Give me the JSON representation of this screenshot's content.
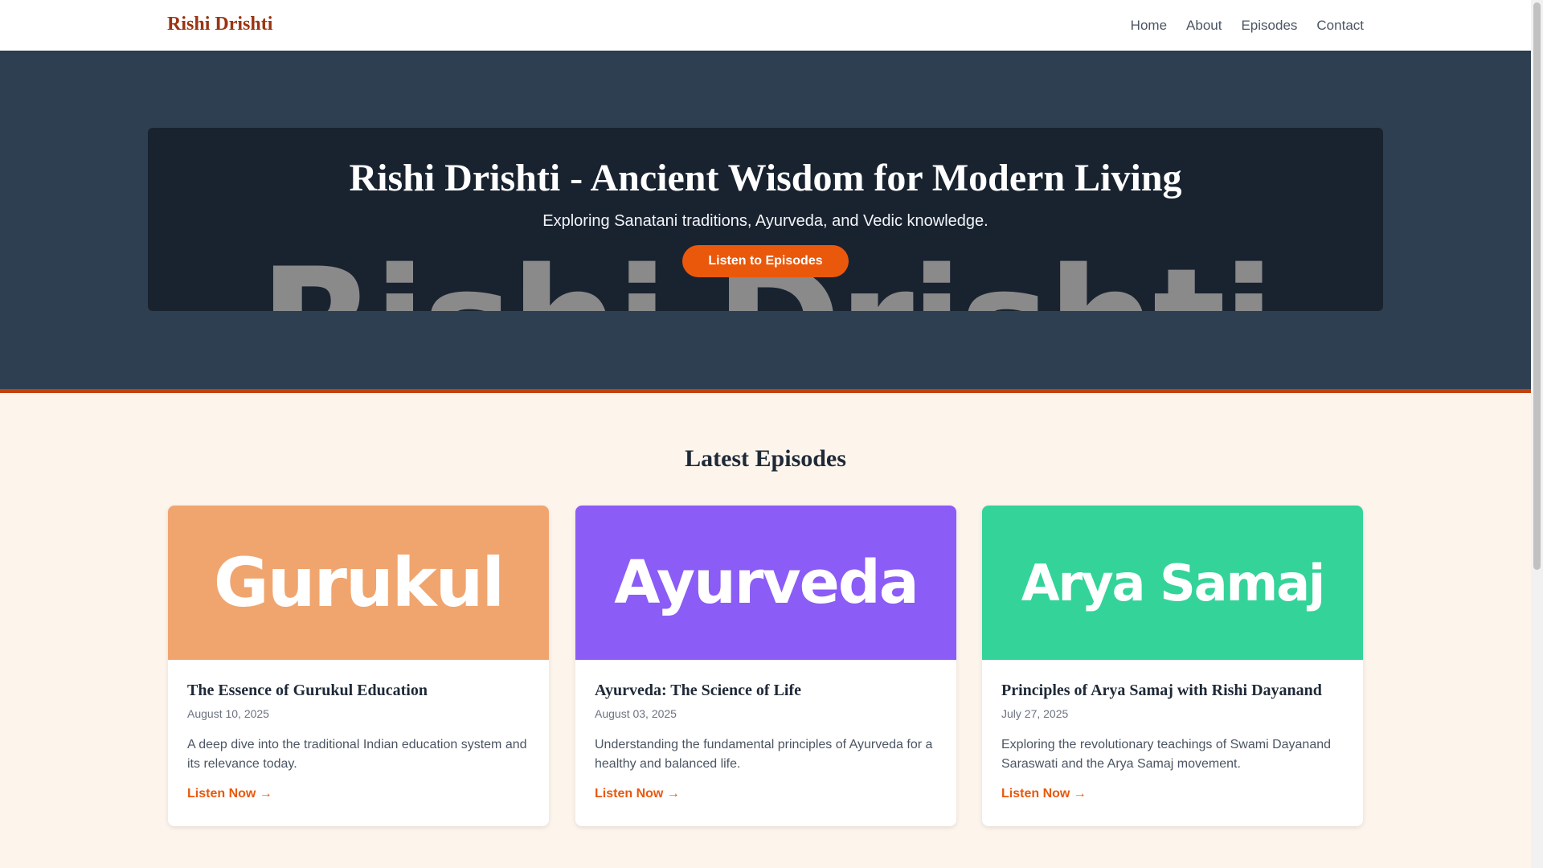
{
  "header": {
    "logo": "Rishi Drishti",
    "nav": [
      {
        "label": "Home"
      },
      {
        "label": "About"
      },
      {
        "label": "Episodes"
      },
      {
        "label": "Contact"
      }
    ]
  },
  "hero": {
    "watermark": "Rishi Drishti",
    "title": "Rishi Drishti - Ancient Wisdom for Modern Living",
    "subtitle": "Exploring Sanatani traditions, Ayurveda, and Vedic knowledge.",
    "cta_label": "Listen to Episodes"
  },
  "episodes": {
    "heading": "Latest Episodes",
    "items": [
      {
        "thumb_text": "Gurukul",
        "thumb_color": "#f0a56f",
        "title": "The Essence of Gurukul Education",
        "date": "August 10, 2025",
        "description": "A deep dive into the traditional Indian education system and its relevance today.",
        "link_label": "Listen Now →"
      },
      {
        "thumb_text": "Ayurveda",
        "thumb_color": "#8b5cf6",
        "title": "Ayurveda: The Science of Life",
        "date": "August 03, 2025",
        "description": "Understanding the fundamental principles of Ayurveda for a healthy and balanced life.",
        "link_label": "Listen Now →"
      },
      {
        "thumb_text": "Arya Samaj",
        "thumb_color": "#34d399",
        "title": "Principles of Arya Samaj with Rishi Dayanand",
        "date": "July 27, 2025",
        "description": "Exploring the revolutionary teachings of Swami Dayanand Saraswati and the Arya Samaj movement.",
        "link_label": "Listen Now →"
      }
    ]
  },
  "colors": {
    "brand": "#9a3412",
    "accent": "#ea580c",
    "hero_background": "#2e3f52",
    "page_background": "#fdf5ec"
  }
}
